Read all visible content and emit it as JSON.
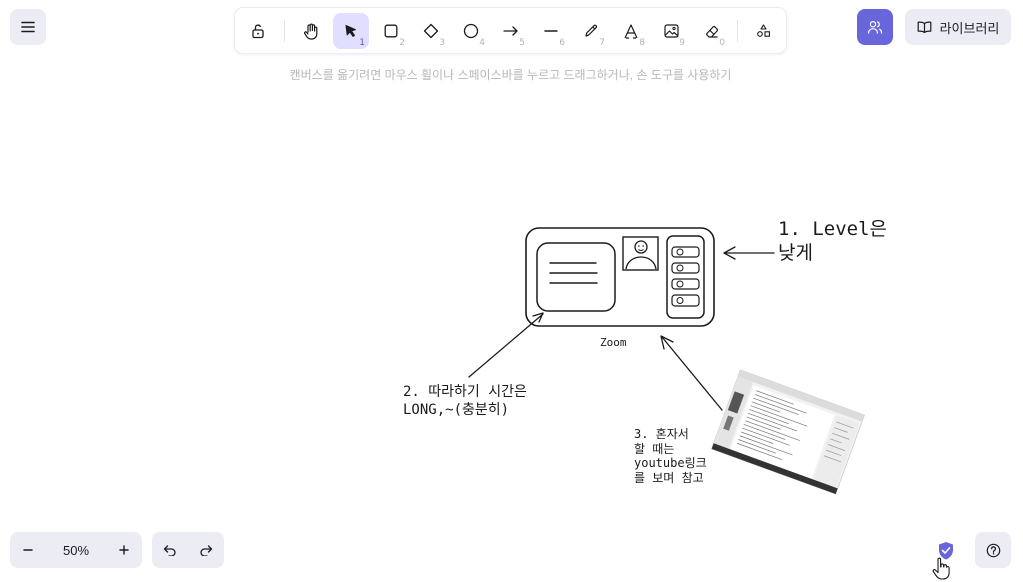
{
  "menu": {
    "icon": "hamburger-icon"
  },
  "toolbar": {
    "tools": [
      {
        "name": "lock",
        "icon": "unlock-icon",
        "key": ""
      },
      {
        "name": "hand",
        "icon": "hand-icon",
        "key": ""
      },
      {
        "name": "selection",
        "icon": "pointer-icon",
        "key": "1",
        "active": true
      },
      {
        "name": "rectangle",
        "icon": "square-icon",
        "key": "2"
      },
      {
        "name": "diamond",
        "icon": "diamond-icon",
        "key": "3"
      },
      {
        "name": "ellipse",
        "icon": "circle-icon",
        "key": "4"
      },
      {
        "name": "arrow",
        "icon": "arrow-icon",
        "key": "5"
      },
      {
        "name": "line",
        "icon": "line-icon",
        "key": "6"
      },
      {
        "name": "draw",
        "icon": "pencil-icon",
        "key": "7"
      },
      {
        "name": "text",
        "icon": "text-icon",
        "key": "8"
      },
      {
        "name": "image",
        "icon": "image-icon",
        "key": "9"
      },
      {
        "name": "eraser",
        "icon": "eraser-icon",
        "key": "0"
      },
      {
        "name": "more",
        "icon": "shapes-icon",
        "key": ""
      }
    ]
  },
  "share": {
    "icon": "users-icon"
  },
  "library": {
    "label": "라이브러리",
    "icon": "book-icon"
  },
  "hint": "캔버스를 옮기려면 마우스 휠이나 스페이스바를 누르고 드래그하거나, 손 도구를 사용하기",
  "canvas": {
    "note1_line1": "1. Level은",
    "note1_line2": "낮게",
    "zoom_label": "Zoom",
    "note2_line1": "2. 따라하기 시간은",
    "note2_line2": "LONG,~(충분히)",
    "note3_line1": "3. 혼자서",
    "note3_line2": "할 때는",
    "note3_line3": "youtube링크",
    "note3_line4": "를 보며 참고"
  },
  "zoom": {
    "value": "50%",
    "minus": "−",
    "plus": "+"
  },
  "history": {
    "undo_icon": "undo-icon",
    "redo_icon": "redo-icon"
  },
  "status": {
    "shield_icon": "shield-check-icon",
    "help_icon": "help-icon"
  },
  "colors": {
    "accent": "#6965db",
    "accent_light": "#e0dfff",
    "panel": "#ececf4",
    "hint": "#b8b8b8"
  }
}
